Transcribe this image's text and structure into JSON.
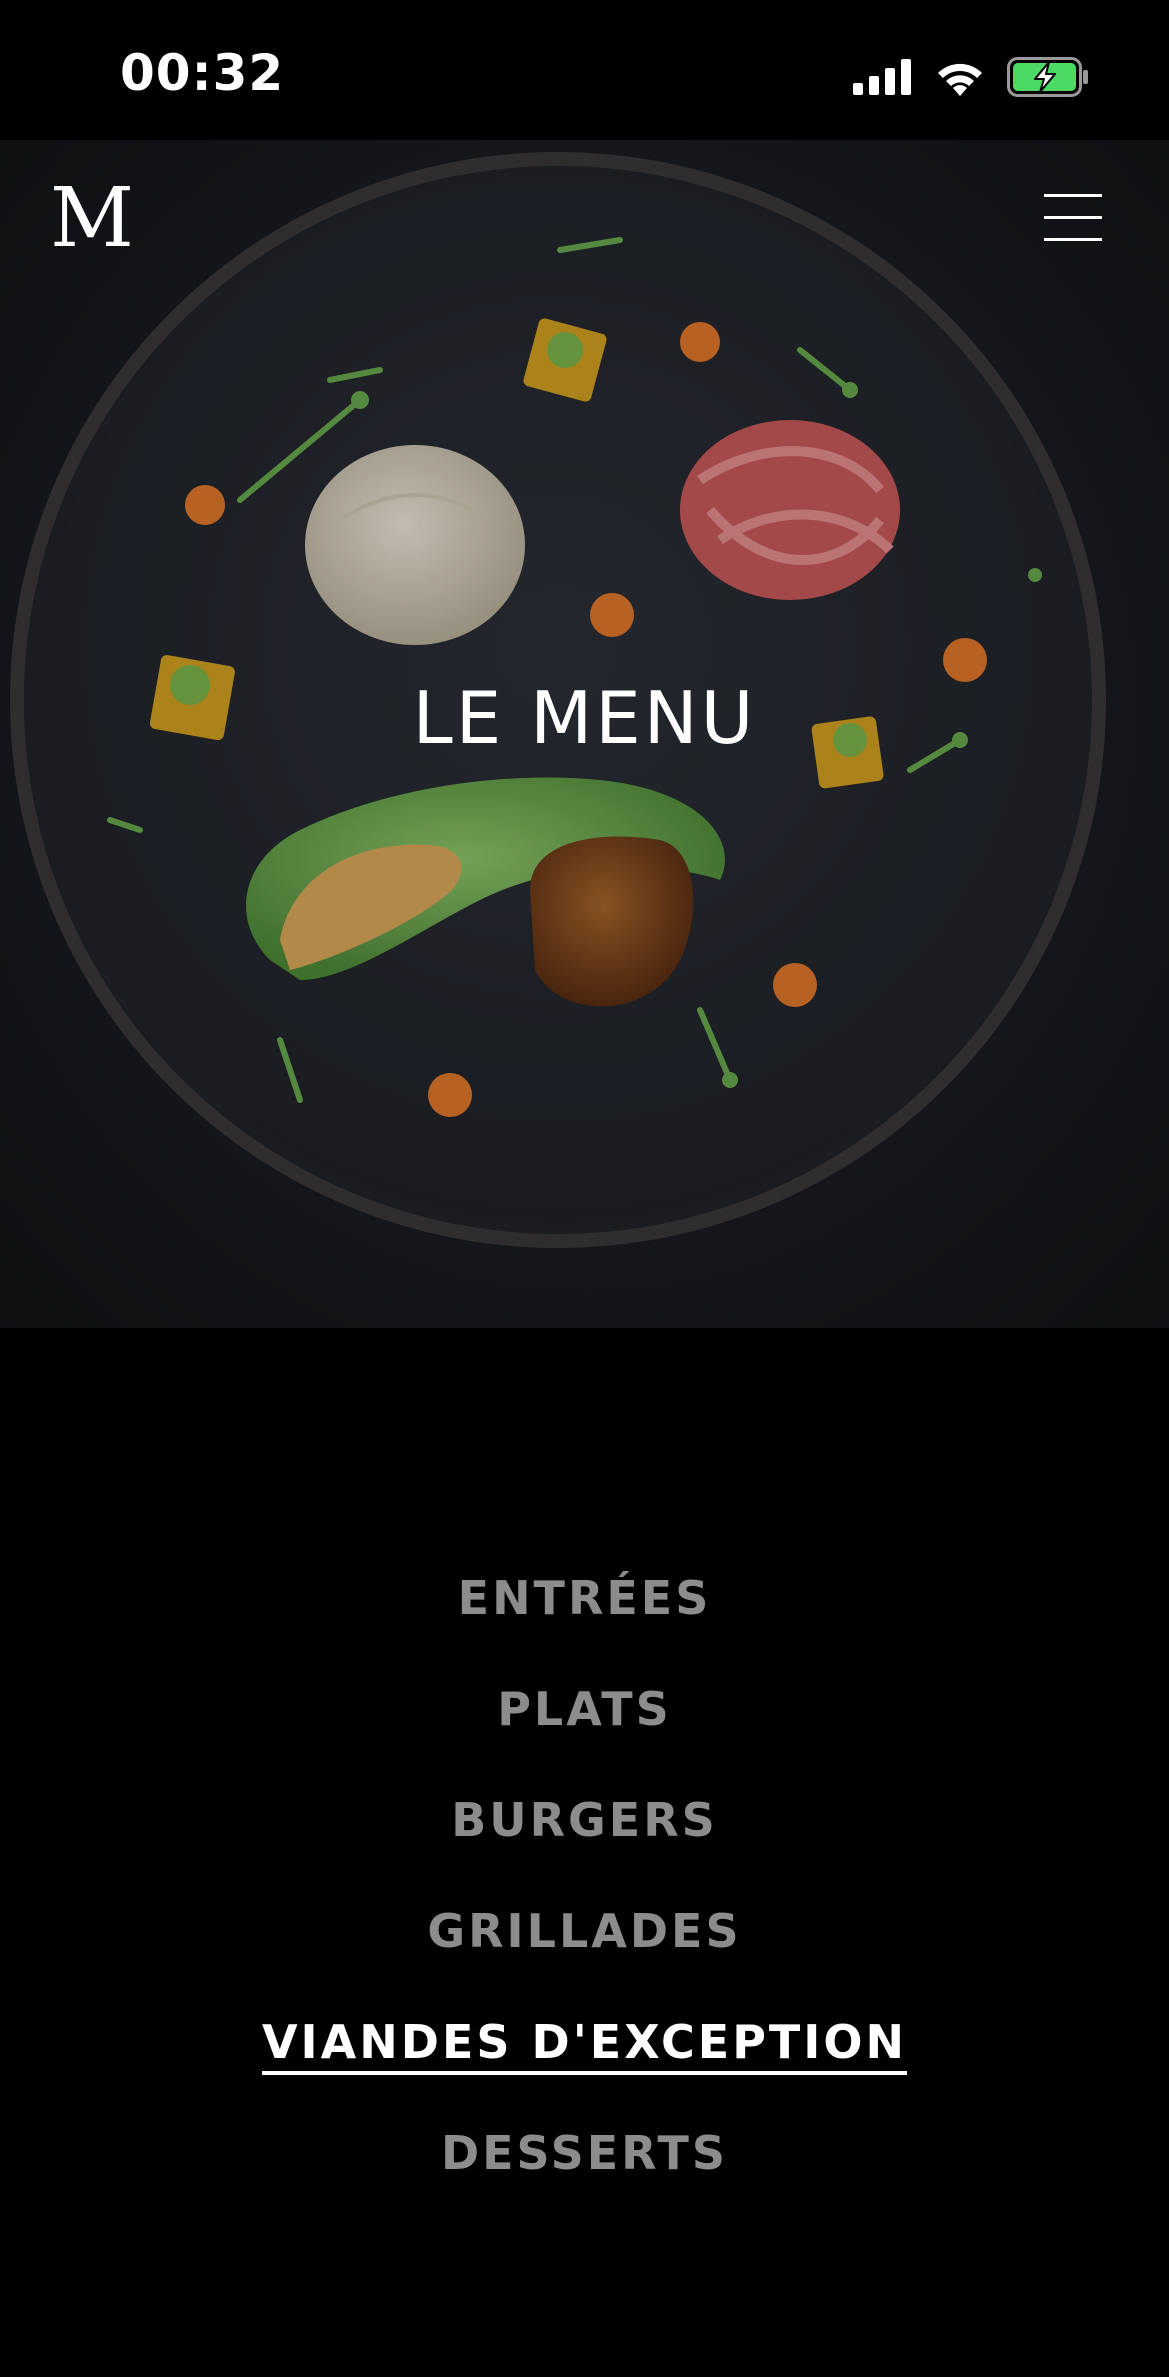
{
  "status_bar": {
    "time": "00:32",
    "icons": [
      "cellular-signal-icon",
      "wifi-icon",
      "battery-charging-icon"
    ]
  },
  "header": {
    "logo": "M",
    "menu_icon": "hamburger-menu-icon"
  },
  "hero": {
    "title": "LE MENU",
    "image": "plated-dish-photo"
  },
  "categories": [
    {
      "label": "ENTRÉES",
      "active": false
    },
    {
      "label": "PLATS",
      "active": false
    },
    {
      "label": "BURGERS",
      "active": false
    },
    {
      "label": "GRILLADES",
      "active": false
    },
    {
      "label": "VIANDES D'EXCEPTION",
      "active": true
    },
    {
      "label": "DESSERTS",
      "active": false
    }
  ],
  "colors": {
    "background": "#000000",
    "inactive_text": "#8c8c8c",
    "active_text": "#ffffff",
    "battery_fill": "#4cd964"
  }
}
